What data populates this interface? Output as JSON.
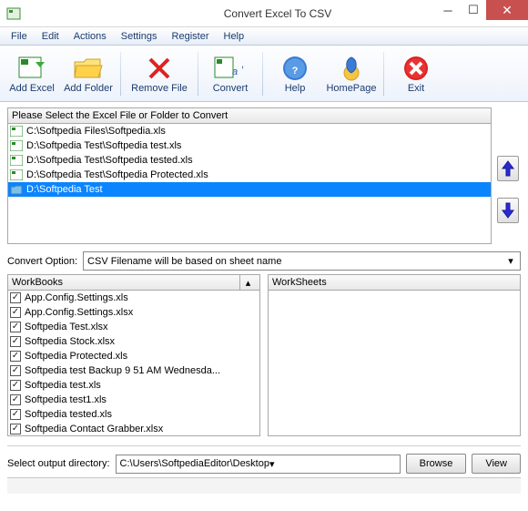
{
  "window": {
    "title": "Convert Excel To CSV"
  },
  "menu": {
    "file": "File",
    "edit": "Edit",
    "actions": "Actions",
    "settings": "Settings",
    "register": "Register",
    "help": "Help"
  },
  "toolbar": {
    "add_excel": "Add Excel",
    "add_folder": "Add Folder",
    "remove_file": "Remove File",
    "convert": "Convert",
    "help": "Help",
    "homepage": "HomePage",
    "exit": "Exit"
  },
  "filepanel": {
    "header": "Please Select the Excel File or Folder to Convert",
    "items": [
      {
        "type": "xls",
        "path": "C:\\Softpedia Files\\Softpedia.xls"
      },
      {
        "type": "xls",
        "path": "D:\\Softpedia Test\\Softpedia test.xls"
      },
      {
        "type": "xls",
        "path": "D:\\Softpedia Test\\Softpedia tested.xls"
      },
      {
        "type": "xls",
        "path": "D:\\Softpedia Test\\Softpedia Protected.xls"
      },
      {
        "type": "folder",
        "path": "D:\\Softpedia Test",
        "selected": true
      }
    ]
  },
  "convert_option": {
    "label": "Convert Option:",
    "value": "CSV Filename will be based on sheet name"
  },
  "workbooks": {
    "header": "WorkBooks",
    "items": [
      "App.Config.Settings.xls",
      "App.Config.Settings.xlsx",
      "Softpedia Test.xlsx",
      "Softpedia Stock.xlsx",
      "Softpedia Protected.xls",
      "Softpedia test Backup 9 51 AM Wednesda...",
      "Softpedia test.xls",
      "Softpedia test1.xls",
      "Softpedia tested.xls",
      "Softpedia Contact Grabber.xlsx"
    ]
  },
  "worksheets": {
    "header": "WorkSheets"
  },
  "output": {
    "label": "Select  output directory:",
    "value": "C:\\Users\\SoftpediaEditor\\Desktop",
    "browse": "Browse",
    "view": "View"
  }
}
